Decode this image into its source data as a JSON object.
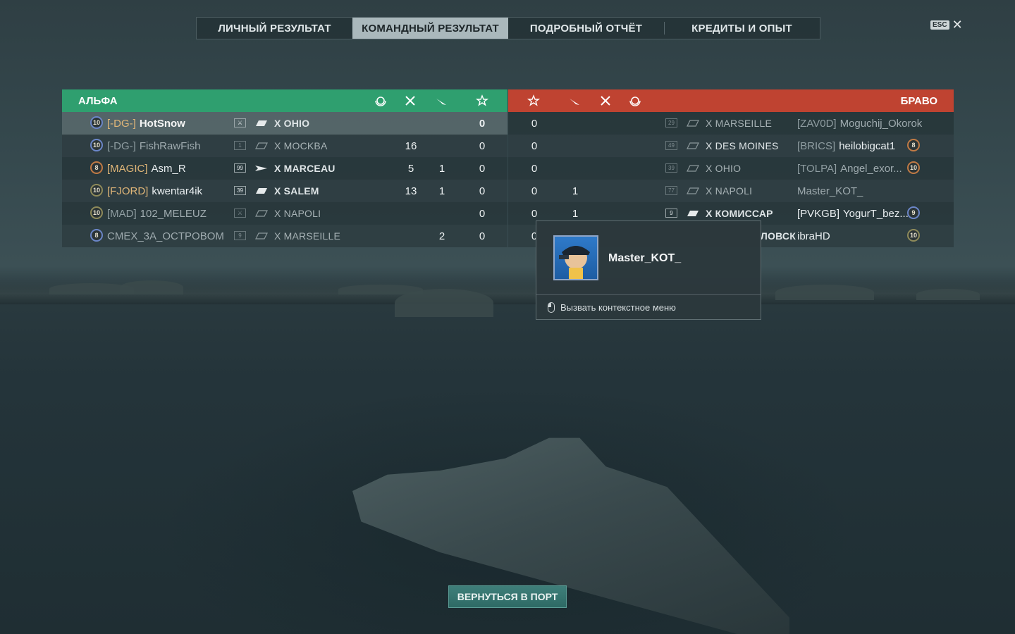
{
  "tabs": [
    {
      "label": "ЛИЧНЫЙ РЕЗУЛЬТАТ",
      "active": false
    },
    {
      "label": "КОМАНДНЫЙ РЕЗУЛЬТАТ",
      "active": true
    },
    {
      "label": "ПОДРОБНЫЙ ОТЧЁТ",
      "active": false
    },
    {
      "label": "КРЕДИТЫ И ОПЫТ",
      "active": false
    }
  ],
  "esc": {
    "badge": "ESC",
    "close": "✕"
  },
  "alpha": {
    "name": "АЛЬФА",
    "color": "#2f9f6f",
    "header_icons": [
      "laurel-icon",
      "kills-icon",
      "plane-icon",
      "star-icon"
    ],
    "rows": [
      {
        "level": "10",
        "clan": "[-DG-]",
        "player": "HotSnow",
        "tier": "⚔",
        "ship": "X  OHIO",
        "kills": "",
        "planes": "",
        "stars": "0"
      },
      {
        "level": "10",
        "clan": "[-DG-]",
        "player": "FishRawFish",
        "tier": "1",
        "ship": "X  MOCKBA",
        "kills": "16",
        "planes": "",
        "stars": "0"
      },
      {
        "level": "8",
        "clan": "[MAGIC]",
        "player": "Asm_R",
        "tier": "99",
        "ship": "X  MARCEAU",
        "kills": "5",
        "planes": "1",
        "stars": "0"
      },
      {
        "level": "10",
        "clan": "[FJORD]",
        "player": "kwentar4ik",
        "tier": "39",
        "ship": "X  SALEM",
        "kills": "13",
        "planes": "1",
        "stars": "0"
      },
      {
        "level": "10",
        "clan": "[MAD]",
        "player": "102_MELEUZ",
        "tier": "⚔",
        "ship": "X  NAPOLI",
        "kills": "",
        "planes": "",
        "stars": "0"
      },
      {
        "level": "8",
        "clan": "",
        "player": "CMEX_3A_OCTPOBOM",
        "tier": "9",
        "ship": "X  MARSEILLE",
        "kills": "",
        "planes": "2",
        "stars": "0"
      }
    ]
  },
  "bravo": {
    "name": "БРАВО",
    "color": "#bf4331",
    "header_icons": [
      "star-icon",
      "plane-icon",
      "kills-icon",
      "laurel-icon"
    ],
    "rows": [
      {
        "stars": "0",
        "planes": "",
        "tier": "29",
        "ship": "X  MARSEILLE",
        "clan": "[ZAV0D]",
        "player": "Moguchij_Okorok",
        "level": ""
      },
      {
        "stars": "0",
        "planes": "",
        "tier": "49",
        "ship": "X  DES MOINES",
        "clan": "[BRICS]",
        "player": "heilobigcat1",
        "level": "8"
      },
      {
        "stars": "0",
        "planes": "",
        "tier": "39",
        "ship": "X  OHIO",
        "clan": "[TOLPA]",
        "player": "Angel_exor...",
        "level": "10"
      },
      {
        "stars": "0",
        "planes": "1",
        "tier": "77",
        "ship": "X  NAPOLI",
        "clan": "",
        "player": "Master_KOT_",
        "level": ""
      },
      {
        "stars": "0",
        "planes": "1",
        "tier": "9",
        "ship": "X  КОМИССАР",
        "clan": "[PVKGB]",
        "player": "YogurT_bez...",
        "level": "9"
      },
      {
        "stars": "0",
        "planes": "",
        "tier": "",
        "ship": "ЛОВСК",
        "clan": "",
        "player": "ibraHD",
        "level": "10"
      }
    ]
  },
  "popup": {
    "player": "Master_KOT_",
    "hint": "Вызвать контекстное меню",
    "avatar": "captain-avatar"
  },
  "back_button": "ВЕРНУТЬСЯ В ПОРТ"
}
